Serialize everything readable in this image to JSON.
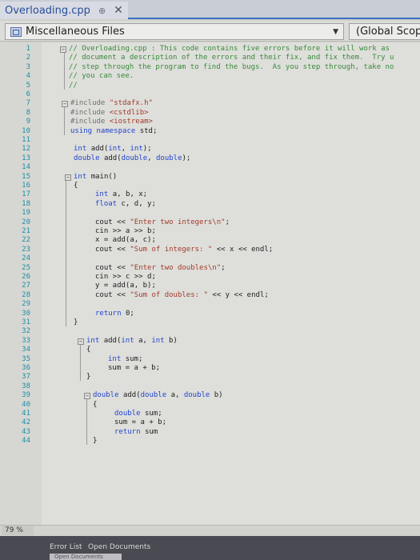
{
  "tab": {
    "title": "Overloading.cpp",
    "pin_glyph": "⊕",
    "close_glyph": "✕"
  },
  "navbar": {
    "project": "Miscellaneous Files",
    "scope": "(Global Scope"
  },
  "editor": {
    "lines": [
      {
        "n": "1",
        "parts": [
          {
            "t": "// Overloading.cpp : This code contains five errors before it will work as",
            "c": "cm"
          }
        ],
        "indent": 0,
        "fold": "−"
      },
      {
        "n": "2",
        "parts": [
          {
            "t": "// document a description of the errors and their fix, and fix them.  Try u",
            "c": "cm"
          }
        ],
        "indent": 0
      },
      {
        "n": "3",
        "parts": [
          {
            "t": "// step through the program to find the bugs.  As you step through, take no",
            "c": "cm"
          }
        ],
        "indent": 0
      },
      {
        "n": "4",
        "parts": [
          {
            "t": "// you can see.",
            "c": "cm"
          }
        ],
        "indent": 0
      },
      {
        "n": "5",
        "parts": [
          {
            "t": "//",
            "c": "cm"
          }
        ],
        "indent": 0
      },
      {
        "n": "6",
        "parts": [],
        "indent": 0
      },
      {
        "n": "7",
        "parts": [
          {
            "t": "#include ",
            "c": "pp"
          },
          {
            "t": "\"stdafx.h\"",
            "c": "str"
          }
        ],
        "indent": 0,
        "fold": "−"
      },
      {
        "n": "8",
        "parts": [
          {
            "t": "#include ",
            "c": "pp"
          },
          {
            "t": "<cstdlib>",
            "c": "str"
          }
        ],
        "indent": 0
      },
      {
        "n": "9",
        "parts": [
          {
            "t": "#include ",
            "c": "pp"
          },
          {
            "t": "<iostream>",
            "c": "str"
          }
        ],
        "indent": 0
      },
      {
        "n": "10",
        "parts": [
          {
            "t": "using namespace ",
            "c": "kw"
          },
          {
            "t": "std;",
            "c": ""
          }
        ],
        "indent": 0
      },
      {
        "n": "11",
        "parts": [],
        "indent": 0
      },
      {
        "n": "12",
        "parts": [
          {
            "t": "int ",
            "c": "kw"
          },
          {
            "t": "add(",
            "c": ""
          },
          {
            "t": "int",
            "c": "kw"
          },
          {
            "t": ", ",
            "c": ""
          },
          {
            "t": "int",
            "c": "kw"
          },
          {
            "t": ");",
            "c": ""
          }
        ],
        "indent": 0
      },
      {
        "n": "13",
        "parts": [
          {
            "t": "double ",
            "c": "kw"
          },
          {
            "t": "add(",
            "c": ""
          },
          {
            "t": "double",
            "c": "kw"
          },
          {
            "t": ", ",
            "c": ""
          },
          {
            "t": "double",
            "c": "kw"
          },
          {
            "t": ");",
            "c": ""
          }
        ],
        "indent": 0
      },
      {
        "n": "14",
        "parts": [],
        "indent": 0
      },
      {
        "n": "15",
        "parts": [
          {
            "t": "int ",
            "c": "kw"
          },
          {
            "t": "main()",
            "c": ""
          }
        ],
        "indent": 0,
        "fold": "−"
      },
      {
        "n": "16",
        "parts": [
          {
            "t": "{",
            "c": ""
          }
        ],
        "indent": 0
      },
      {
        "n": "17",
        "parts": [
          {
            "t": "int ",
            "c": "kw"
          },
          {
            "t": "a, b, x;",
            "c": ""
          }
        ],
        "indent": 1
      },
      {
        "n": "18",
        "parts": [
          {
            "t": "float ",
            "c": "kw"
          },
          {
            "t": "c, d, y;",
            "c": ""
          }
        ],
        "indent": 1
      },
      {
        "n": "19",
        "parts": [],
        "indent": 0
      },
      {
        "n": "20",
        "parts": [
          {
            "t": "cout << ",
            "c": ""
          },
          {
            "t": "\"Enter two integers\\n\"",
            "c": "str"
          },
          {
            "t": ";",
            "c": ""
          }
        ],
        "indent": 1
      },
      {
        "n": "21",
        "parts": [
          {
            "t": "cin >> a >> b;",
            "c": ""
          }
        ],
        "indent": 1
      },
      {
        "n": "22",
        "parts": [
          {
            "t": "x = add(a, c);",
            "c": ""
          }
        ],
        "indent": 1
      },
      {
        "n": "23",
        "parts": [
          {
            "t": "cout << ",
            "c": ""
          },
          {
            "t": "\"Sum of integers: \"",
            "c": "str"
          },
          {
            "t": " << x << endl;",
            "c": ""
          }
        ],
        "indent": 1
      },
      {
        "n": "24",
        "parts": [],
        "indent": 0
      },
      {
        "n": "25",
        "parts": [
          {
            "t": "cout << ",
            "c": ""
          },
          {
            "t": "\"Enter two doubles\\n\"",
            "c": "str"
          },
          {
            "t": ";",
            "c": ""
          }
        ],
        "indent": 1
      },
      {
        "n": "26",
        "parts": [
          {
            "t": "cin >> c >> d;",
            "c": ""
          }
        ],
        "indent": 1
      },
      {
        "n": "27",
        "parts": [
          {
            "t": "y = add(a, b);",
            "c": ""
          }
        ],
        "indent": 1
      },
      {
        "n": "28",
        "parts": [
          {
            "t": "cout << ",
            "c": ""
          },
          {
            "t": "\"Sum of doubles: \"",
            "c": "str"
          },
          {
            "t": " << y << endl;",
            "c": ""
          }
        ],
        "indent": 1
      },
      {
        "n": "29",
        "parts": [],
        "indent": 0
      },
      {
        "n": "30",
        "parts": [
          {
            "t": "return ",
            "c": "kw"
          },
          {
            "t": "0;",
            "c": ""
          }
        ],
        "indent": 1
      },
      {
        "n": "31",
        "parts": [
          {
            "t": "}",
            "c": ""
          }
        ],
        "indent": 0
      },
      {
        "n": "32",
        "parts": [],
        "indent": 0
      },
      {
        "n": "33",
        "parts": [
          {
            "t": "int ",
            "c": "kw"
          },
          {
            "t": "add(",
            "c": ""
          },
          {
            "t": "int ",
            "c": "kw"
          },
          {
            "t": "a, ",
            "c": ""
          },
          {
            "t": "int ",
            "c": "kw"
          },
          {
            "t": "b)",
            "c": ""
          }
        ],
        "indent": 0,
        "fold": "−"
      },
      {
        "n": "34",
        "parts": [
          {
            "t": "{",
            "c": ""
          }
        ],
        "indent": 0
      },
      {
        "n": "35",
        "parts": [
          {
            "t": "int ",
            "c": "kw"
          },
          {
            "t": "sum;",
            "c": ""
          }
        ],
        "indent": 1
      },
      {
        "n": "36",
        "parts": [
          {
            "t": "sum = a + b;",
            "c": ""
          }
        ],
        "indent": 1
      },
      {
        "n": "37",
        "parts": [
          {
            "t": "}",
            "c": ""
          }
        ],
        "indent": 0
      },
      {
        "n": "38",
        "parts": [],
        "indent": 0
      },
      {
        "n": "39",
        "parts": [
          {
            "t": "double ",
            "c": "kw"
          },
          {
            "t": "add(",
            "c": ""
          },
          {
            "t": "double ",
            "c": "kw"
          },
          {
            "t": "a, ",
            "c": ""
          },
          {
            "t": "double ",
            "c": "kw"
          },
          {
            "t": "b)",
            "c": ""
          }
        ],
        "indent": 0,
        "fold": "−"
      },
      {
        "n": "40",
        "parts": [
          {
            "t": "{",
            "c": ""
          }
        ],
        "indent": 0
      },
      {
        "n": "41",
        "parts": [
          {
            "t": "double ",
            "c": "kw"
          },
          {
            "t": "sum;",
            "c": ""
          }
        ],
        "indent": 1
      },
      {
        "n": "42",
        "parts": [
          {
            "t": "sum = a + b;",
            "c": ""
          }
        ],
        "indent": 1
      },
      {
        "n": "43",
        "parts": [
          {
            "t": "return ",
            "c": "kw"
          },
          {
            "t": "sum",
            "c": ""
          }
        ],
        "indent": 1
      },
      {
        "n": "44",
        "parts": [
          {
            "t": "}",
            "c": ""
          }
        ],
        "indent": 0
      }
    ]
  },
  "status": {
    "zoom": "79 %",
    "panel_tabs": [
      "Error List",
      "Open Documents"
    ],
    "sub_tab": "Open Documents"
  }
}
